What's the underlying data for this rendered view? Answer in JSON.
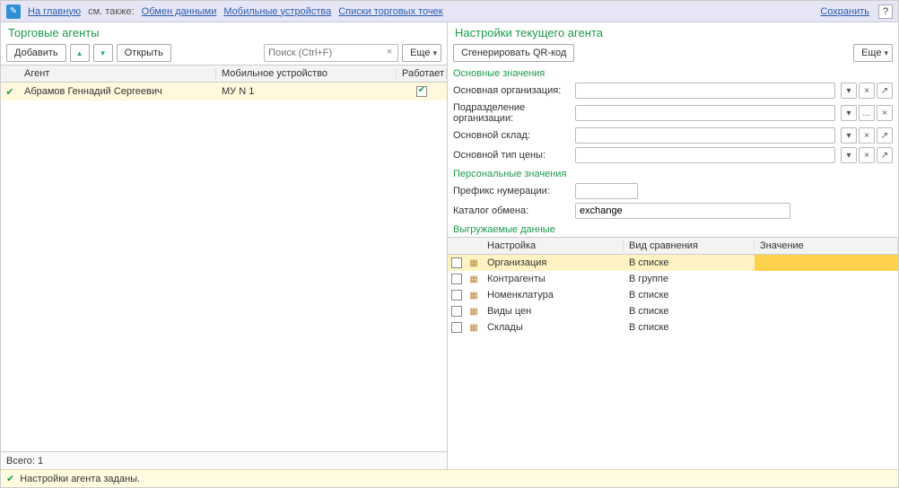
{
  "topbar": {
    "home": "На главную",
    "see_also": "см. также:",
    "link_exchange": "Обмен данными",
    "link_mobile": "Мобильные устройства",
    "link_pos": "Списки торговых точек",
    "save": "Сохранить",
    "help": "?"
  },
  "left": {
    "title": "Торговые агенты",
    "btn_add": "Добавить",
    "btn_open": "Открыть",
    "search_placeholder": "Поиск (Ctrl+F)",
    "btn_more": "Еще",
    "col_agent": "Агент",
    "col_device": "Мобильное устройство",
    "col_works": "Работает",
    "rows": [
      {
        "agent": "Абрамов Геннадий Сергеевич",
        "device": "МУ N 1",
        "works": true
      }
    ],
    "footer_total_label": "Всего:",
    "footer_total_value": "1"
  },
  "right": {
    "title": "Настройки текущего агента",
    "btn_qr": "Сгенерировать QR-код",
    "btn_more": "Еще",
    "section_main": "Основные значения",
    "f_org": "Основная организация:",
    "f_dept": "Подразделение организации:",
    "f_wh": "Основной склад:",
    "f_price": "Основной тип цены:",
    "section_personal": "Персональные значения",
    "f_prefix": "Префикс нумерации:",
    "f_catalog": "Каталог обмена:",
    "catalog_value": "exchange",
    "section_upload": "Выгружаемые данные",
    "col_setting": "Настройка",
    "col_compare": "Вид сравнения",
    "col_value": "Значение",
    "rows": [
      {
        "name": "Организация",
        "cmp": "В списке",
        "sel": true
      },
      {
        "name": "Контрагенты",
        "cmp": "В группе"
      },
      {
        "name": "Номенклатура",
        "cmp": "В списке"
      },
      {
        "name": "Виды цен",
        "cmp": "В списке"
      },
      {
        "name": "Склады",
        "cmp": "В списке"
      }
    ]
  },
  "status": "Настройки агента заданы."
}
